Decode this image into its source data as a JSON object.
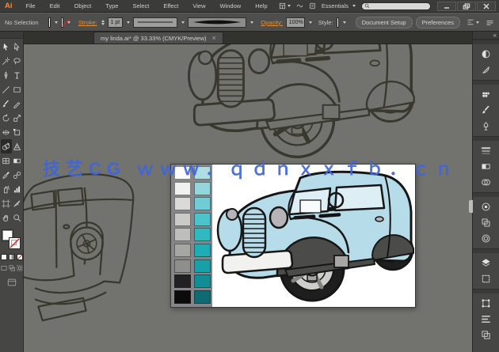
{
  "app": {
    "name": "Adobe Illustrator"
  },
  "menu_bar": {
    "logo": "Ai",
    "items": [
      "File",
      "Edit",
      "Object",
      "Type",
      "Select",
      "Effect",
      "View",
      "Window",
      "Help"
    ],
    "workspace_switcher": "Essentials",
    "search_placeholder": "",
    "window_controls": {
      "minimize": "minimize",
      "restore": "restore",
      "close": "close"
    }
  },
  "control_bar": {
    "selection_status": "No Selection",
    "stroke_label": "Stroke:",
    "stroke_value": "1 pt",
    "opacity_label": "Opacity:",
    "opacity_value": "100%",
    "style_label": "Style:",
    "document_setup_label": "Document Setup",
    "preferences_label": "Preferences"
  },
  "document_tab": {
    "title": "my linda.ai* @ 33.33% (CMYK/Preview)",
    "close_glyph": "×"
  },
  "toolbar": {
    "tools": [
      "selection",
      "direct-selection",
      "magic-wand",
      "lasso",
      "pen",
      "type",
      "line-segment",
      "rectangle",
      "paintbrush",
      "pencil",
      "rotate",
      "scale",
      "width",
      "free-transform",
      "shape-builder",
      "perspective-grid",
      "mesh",
      "gradient",
      "eyedropper",
      "blend",
      "symbol-sprayer",
      "column-graph",
      "artboard",
      "slice",
      "hand",
      "zoom"
    ],
    "active_tool": "shape-builder"
  },
  "dock": {
    "collapse_glyph": "«",
    "groups": [
      {
        "panels": [
          "color",
          "color-guide"
        ]
      },
      {
        "panels": [
          "swatches",
          "brushes",
          "symbols"
        ]
      },
      {
        "panels": [
          "stroke",
          "gradient",
          "transparency"
        ]
      },
      {
        "panels": [
          "appearance",
          "graphic-styles",
          "image-trace"
        ]
      },
      {
        "panels": [
          "layers",
          "artboards"
        ]
      },
      {
        "panels": [
          "transform",
          "align",
          "pathfinder"
        ]
      }
    ]
  },
  "canvas": {
    "background_color": "#72726e",
    "line_art_color": "#38382f",
    "watermark": {
      "text": "技艺CG ｗｗｗ．ｑｄｎｘｘｆｂ．ｃｎ",
      "color": "#4166d8"
    }
  },
  "artboard_image": {
    "palette": {
      "grays": [
        "#fbfbfb",
        "#f1f1ef",
        "#dadad8",
        "#cacac8",
        "#bebebc",
        "#a6a6a4",
        "#8e8e8c",
        "#212121",
        "#0b0b0b"
      ],
      "teals": [
        "#aedee3",
        "#93d7dd",
        "#70cdd5",
        "#4cc3cb",
        "#2fb9c1",
        "#1fadb5",
        "#189fa8",
        "#128d95",
        "#0d6b71"
      ]
    },
    "car_colors": {
      "body": "#b7dce9",
      "windows": "#ddeef5",
      "window_inner": "#f8fbfc",
      "headlight": "#b6b4b6",
      "bumper": "#f1f1ef",
      "tire": "#1e1e1e",
      "rim": "#cdcdcb",
      "spokes": "#84827f",
      "hub": "#a8a6a4",
      "shadow": "#4b4b49",
      "outline": "#161616",
      "vents": "#121212"
    }
  }
}
